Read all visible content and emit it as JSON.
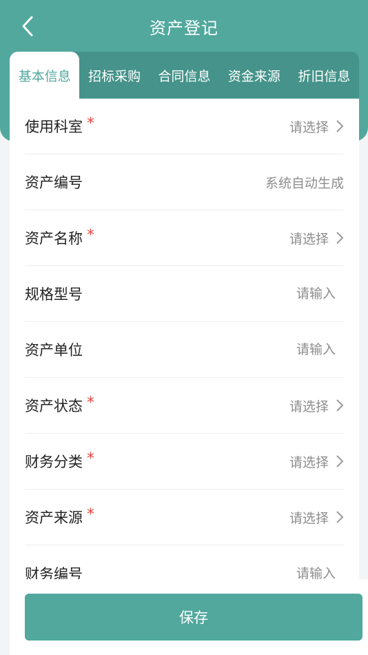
{
  "header": {
    "title": "资产登记",
    "bg_color": "#52a89d"
  },
  "tabs": [
    {
      "label": "基本信息",
      "active": true
    },
    {
      "label": "招标采购",
      "active": false
    },
    {
      "label": "合同信息",
      "active": false
    },
    {
      "label": "资金来源",
      "active": false
    },
    {
      "label": "折旧信息",
      "active": false
    }
  ],
  "form": {
    "rows": [
      {
        "label": "使用科室",
        "required": true,
        "type": "select",
        "value": "请选择"
      },
      {
        "label": "资产编号",
        "required": false,
        "type": "static",
        "value": "系统自动生成"
      },
      {
        "label": "资产名称",
        "required": true,
        "type": "select",
        "value": "请选择"
      },
      {
        "label": "规格型号",
        "required": false,
        "type": "input",
        "value": "请输入"
      },
      {
        "label": "资产单位",
        "required": false,
        "type": "input",
        "value": "请输入"
      },
      {
        "label": "资产状态",
        "required": true,
        "type": "select",
        "value": "请选择"
      },
      {
        "label": "财务分类",
        "required": true,
        "type": "select",
        "value": "请选择"
      },
      {
        "label": "资产来源",
        "required": true,
        "type": "select",
        "value": "请选择"
      },
      {
        "label": "财务编号",
        "required": false,
        "type": "input",
        "value": "请输入"
      }
    ],
    "required_mark": "*"
  },
  "footer": {
    "save_label": "保存"
  },
  "colors": {
    "accent": "#52a89d",
    "tab_bar": "#45938a",
    "required": "#e8453c"
  },
  "icons": {
    "back": "chevron-left-icon",
    "row_arrow": "chevron-right-icon"
  }
}
